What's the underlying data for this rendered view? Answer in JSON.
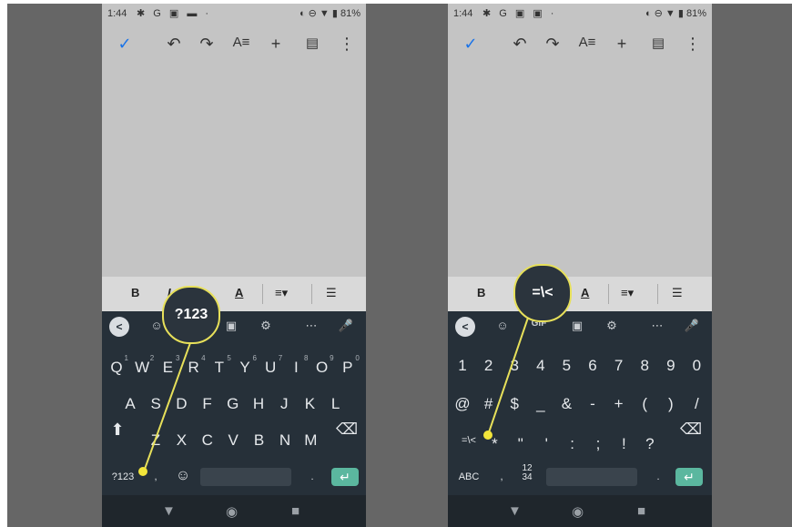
{
  "status": {
    "time": "1:44",
    "icons_left": "G",
    "battery": "81%"
  },
  "left": {
    "callout": "?123",
    "format_bar": {
      "bold": "B",
      "italic": "I",
      "text_color": "A"
    },
    "suggestions": {
      "back": "<"
    },
    "rows": [
      [
        {
          "k": "Q",
          "s": "1"
        },
        {
          "k": "W",
          "s": "2"
        },
        {
          "k": "E",
          "s": "3"
        },
        {
          "k": "R",
          "s": "4"
        },
        {
          "k": "T",
          "s": "5"
        },
        {
          "k": "Y",
          "s": "6"
        },
        {
          "k": "U",
          "s": "7"
        },
        {
          "k": "I",
          "s": "8"
        },
        {
          "k": "O",
          "s": "9"
        },
        {
          "k": "P",
          "s": "0"
        }
      ],
      [
        "A",
        "S",
        "D",
        "F",
        "G",
        "H",
        "J",
        "K",
        "L"
      ],
      [
        "Z",
        "X",
        "C",
        "V",
        "B",
        "N",
        "M"
      ]
    ],
    "bottom": {
      "mode": "?123",
      "comma": ",",
      "period": "."
    }
  },
  "right": {
    "callout": "=\\<",
    "format_bar": {
      "bold": "B",
      "text_color": "A"
    },
    "suggestions": {
      "back": "<",
      "gif": "GIF"
    },
    "rows": [
      [
        "1",
        "2",
        "3",
        "4",
        "5",
        "6",
        "7",
        "8",
        "9",
        "0"
      ],
      [
        "@",
        "#",
        "$",
        "_",
        "&",
        "-",
        "+",
        "(",
        ")",
        "/"
      ],
      [
        "=\\<",
        "*",
        "\"",
        "'",
        ":",
        ";",
        "!",
        "?"
      ]
    ],
    "bottom": {
      "mode": "ABC",
      "comma": ",",
      "numpad": "12\n34",
      "period": "."
    }
  },
  "colors": {
    "accent_callout": "#e7e05a",
    "keyboard_bg": "#263039",
    "enter_key": "#5bb79f",
    "check": "#1a73e8"
  }
}
